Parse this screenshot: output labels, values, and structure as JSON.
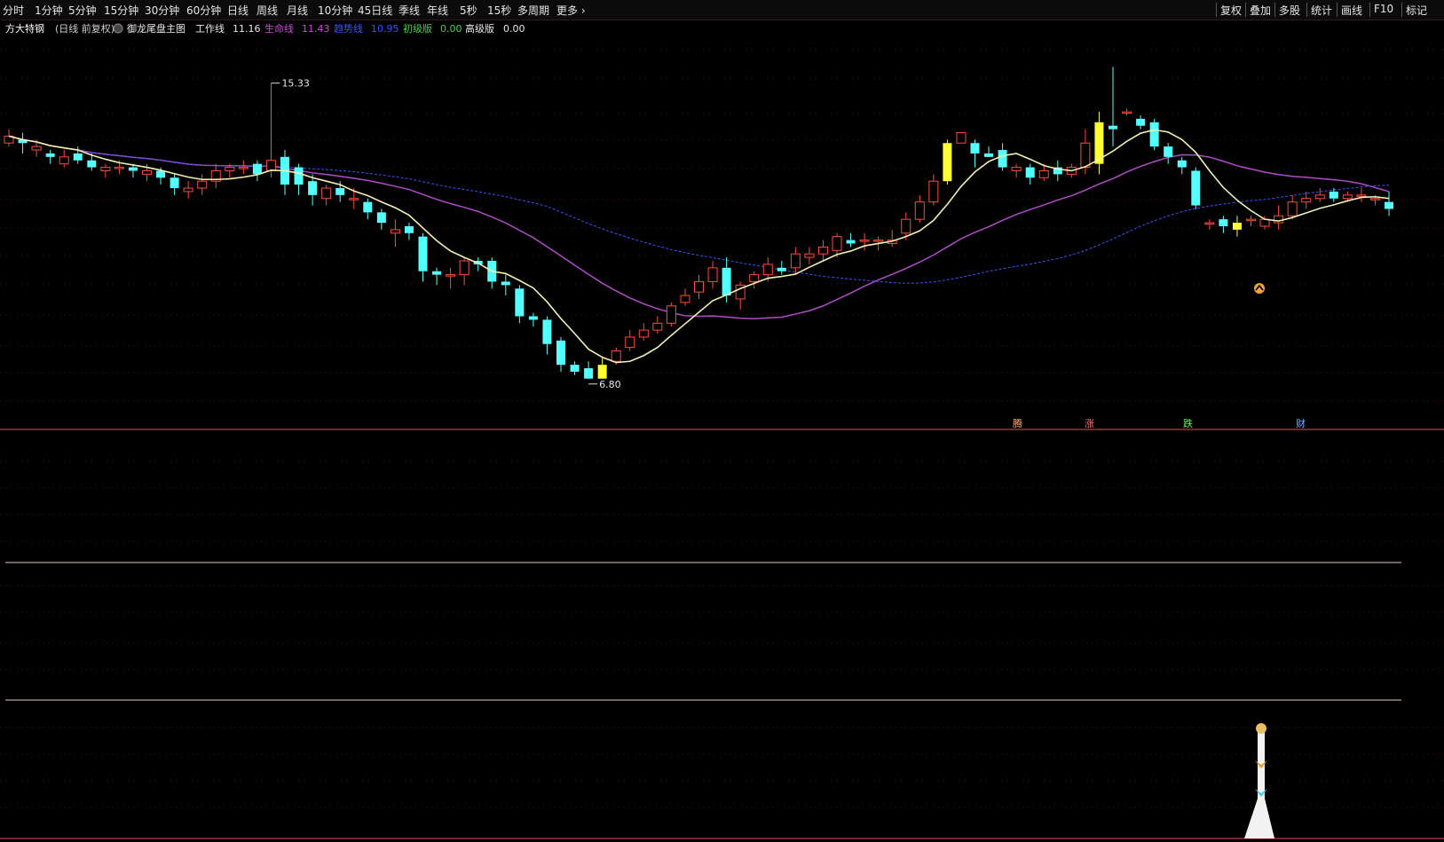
{
  "toolbar": {
    "periods": [
      "分时",
      "1分钟",
      "5分钟",
      "15分钟",
      "30分钟",
      "60分钟",
      "日线",
      "周线",
      "月线",
      "10分钟",
      "45日线",
      "季线",
      "年线",
      "5秒",
      "15秒",
      "多周期",
      "更多"
    ],
    "right_buttons": [
      "复权",
      "叠加",
      "多股",
      "统计",
      "画线",
      "F10",
      "标记"
    ]
  },
  "legend": {
    "stock_name": "方大特钢",
    "period": "(日线 前复权)",
    "indicator": "御龙尾盘主图",
    "work_line_label": "工作线",
    "work_line_value": "11.16",
    "life_line_label": "生命线",
    "life_line_value": "11.43",
    "trend_line_label": "趋势线",
    "trend_line_value": "10.95",
    "basic_label": "初级版",
    "basic_value": "0.00",
    "advanced_label": "高级版",
    "advanced_value": "0.00"
  },
  "price_marks": {
    "high": "15.33",
    "low": "6.80"
  },
  "signals": [
    "腾",
    "涨",
    "跌",
    "财"
  ],
  "colors": {
    "background": "#000000",
    "up_candle": "#ff4a3d",
    "down_candle": "#54ffff",
    "highlight_candle": "#ffff33",
    "work_line": "#f2f0b0",
    "life_line": "#b04bc8",
    "trend_line": "#3a52ff",
    "panel_divider": "#a03030"
  },
  "chart_data": {
    "type": "candlestick",
    "y_range": [
      6.0,
      16.5
    ],
    "candles": [
      [
        13.6,
        13.8,
        14.0,
        13.5
      ],
      [
        13.7,
        13.6,
        13.9,
        13.3
      ],
      [
        13.4,
        13.5,
        13.7,
        13.2
      ],
      [
        13.3,
        13.2,
        13.4,
        13.0
      ],
      [
        13.0,
        13.2,
        13.4,
        12.9
      ],
      [
        13.3,
        13.1,
        13.5,
        13.0
      ],
      [
        13.1,
        12.9,
        13.3,
        12.8
      ],
      [
        12.8,
        12.9,
        13.0,
        12.6
      ],
      [
        12.9,
        12.9,
        13.1,
        12.7
      ],
      [
        12.9,
        12.8,
        13.0,
        12.6
      ],
      [
        12.7,
        12.8,
        13.0,
        12.5
      ],
      [
        12.8,
        12.6,
        12.9,
        12.4
      ],
      [
        12.6,
        12.3,
        12.7,
        12.1
      ],
      [
        12.2,
        12.3,
        12.5,
        12.0
      ],
      [
        12.3,
        12.5,
        12.7,
        12.1
      ],
      [
        12.5,
        12.8,
        13.0,
        12.3
      ],
      [
        12.8,
        12.9,
        13.0,
        12.6
      ],
      [
        12.9,
        12.9,
        13.1,
        12.7
      ],
      [
        13.0,
        12.7,
        13.1,
        12.5
      ],
      [
        12.8,
        13.1,
        15.33,
        12.6
      ],
      [
        13.2,
        12.4,
        13.4,
        12.1
      ],
      [
        12.9,
        12.4,
        13.0,
        12.1
      ],
      [
        12.5,
        12.1,
        12.7,
        11.8
      ],
      [
        12.0,
        12.3,
        12.4,
        11.8
      ],
      [
        12.3,
        12.1,
        12.5,
        11.9
      ],
      [
        12.0,
        12.0,
        12.3,
        11.7
      ],
      [
        11.9,
        11.6,
        12.0,
        11.4
      ],
      [
        11.6,
        11.3,
        11.7,
        11.1
      ],
      [
        11.0,
        11.1,
        11.4,
        10.6
      ],
      [
        11.2,
        11.0,
        11.3,
        10.8
      ],
      [
        10.9,
        9.9,
        11.0,
        9.6
      ],
      [
        9.9,
        9.8,
        10.0,
        9.5
      ],
      [
        9.8,
        9.8,
        10.0,
        9.4
      ],
      [
        9.8,
        10.2,
        10.3,
        9.5
      ],
      [
        10.2,
        10.1,
        10.3,
        9.9
      ],
      [
        10.2,
        9.6,
        10.3,
        9.4
      ],
      [
        9.6,
        9.5,
        9.8,
        9.2
      ],
      [
        9.4,
        8.6,
        9.5,
        8.4
      ],
      [
        8.6,
        8.5,
        8.7,
        8.3
      ],
      [
        8.5,
        7.8,
        8.6,
        7.5
      ],
      [
        7.9,
        7.2,
        8.0,
        7.0
      ],
      [
        7.2,
        7.0,
        7.3,
        6.9
      ],
      [
        7.1,
        6.8,
        7.3,
        6.8
      ],
      [
        6.8,
        7.2,
        7.4,
        6.8
      ],
      [
        7.3,
        7.6,
        7.7,
        7.2
      ],
      [
        7.7,
        8.0,
        8.2,
        7.6
      ],
      [
        8.0,
        8.2,
        8.4,
        7.9
      ],
      [
        8.2,
        8.4,
        8.6,
        8.1
      ],
      [
        8.4,
        8.9,
        9.0,
        8.3
      ],
      [
        9.0,
        9.2,
        9.4,
        8.9
      ],
      [
        9.3,
        9.6,
        9.8,
        9.1
      ],
      [
        9.6,
        10.0,
        10.2,
        9.4
      ],
      [
        10.0,
        9.2,
        10.3,
        9.0
      ],
      [
        9.1,
        9.5,
        9.6,
        8.8
      ],
      [
        9.6,
        9.8,
        9.9,
        9.4
      ],
      [
        9.8,
        10.1,
        10.3,
        9.6
      ],
      [
        10.0,
        9.9,
        10.2,
        9.8
      ],
      [
        10.0,
        10.4,
        10.6,
        9.8
      ],
      [
        10.3,
        10.4,
        10.6,
        10.1
      ],
      [
        10.4,
        10.6,
        10.8,
        10.2
      ],
      [
        10.5,
        10.9,
        11.0,
        10.3
      ],
      [
        10.8,
        10.7,
        11.0,
        10.6
      ],
      [
        10.8,
        10.8,
        11.0,
        10.5
      ],
      [
        10.8,
        10.8,
        10.9,
        10.5
      ],
      [
        10.7,
        10.8,
        11.1,
        10.6
      ],
      [
        11.0,
        11.4,
        11.6,
        10.8
      ],
      [
        11.4,
        11.9,
        12.1,
        11.3
      ],
      [
        11.9,
        12.5,
        12.7,
        11.8
      ],
      [
        12.5,
        13.6,
        13.7,
        12.4
      ],
      [
        13.6,
        13.9,
        13.9,
        13.6
      ],
      [
        13.6,
        13.3,
        13.7,
        12.9
      ],
      [
        13.3,
        13.2,
        13.5,
        13.2
      ],
      [
        13.4,
        12.9,
        13.6,
        12.8
      ],
      [
        12.8,
        12.9,
        13.0,
        12.6
      ],
      [
        12.9,
        12.6,
        13.0,
        12.4
      ],
      [
        12.6,
        12.8,
        13.0,
        12.5
      ],
      [
        12.9,
        12.7,
        13.1,
        12.5
      ],
      [
        12.7,
        12.9,
        13.0,
        12.6
      ],
      [
        12.9,
        13.6,
        14.0,
        12.7
      ],
      [
        13.0,
        14.2,
        14.5,
        12.7
      ],
      [
        14.1,
        14.0,
        15.8,
        13.5
      ],
      [
        14.5,
        14.5,
        14.6,
        14.4
      ],
      [
        14.3,
        14.1,
        14.4,
        14.0
      ],
      [
        14.2,
        13.5,
        14.3,
        13.4
      ],
      [
        13.5,
        13.2,
        13.6,
        13.0
      ],
      [
        13.1,
        12.9,
        13.2,
        12.7
      ],
      [
        12.8,
        11.8,
        12.9,
        11.7
      ],
      [
        11.3,
        11.3,
        11.4,
        11.1
      ],
      [
        11.4,
        11.2,
        11.5,
        11.0
      ],
      [
        11.1,
        11.3,
        11.5,
        10.9
      ],
      [
        11.4,
        11.4,
        11.5,
        11.2
      ],
      [
        11.2,
        11.4,
        11.5,
        11.1
      ],
      [
        11.3,
        11.5,
        11.8,
        11.1
      ],
      [
        11.5,
        11.9,
        12.1,
        11.4
      ],
      [
        11.9,
        12.0,
        12.2,
        11.7
      ],
      [
        12.0,
        12.1,
        12.3,
        11.9
      ],
      [
        12.2,
        12.0,
        12.3,
        11.9
      ],
      [
        12.0,
        12.1,
        12.2,
        11.9
      ],
      [
        12.1,
        12.1,
        12.3,
        11.9
      ],
      [
        12.0,
        12.0,
        12.1,
        11.8
      ],
      [
        11.9,
        11.7,
        12.2,
        11.5
      ]
    ],
    "series": []
  }
}
